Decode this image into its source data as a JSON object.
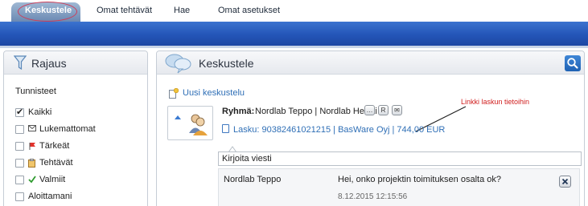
{
  "nav": {
    "tabs": [
      {
        "label": "Keskustele",
        "active": true
      },
      {
        "label": "Omat tehtävät",
        "active": false
      },
      {
        "label": "Hae",
        "active": false
      },
      {
        "label": "Omat asetukset",
        "active": false
      }
    ]
  },
  "filter_panel": {
    "title": "Rajaus",
    "section_label": "Tunnisteet",
    "items": [
      {
        "label": "Kaikki",
        "checked": true,
        "icon": ""
      },
      {
        "label": "Lukemattomat",
        "checked": false,
        "icon": "envelope-icon"
      },
      {
        "label": "Tärkeät",
        "checked": false,
        "icon": "red-flag-icon"
      },
      {
        "label": "Tehtävät",
        "checked": false,
        "icon": "clipboard-icon"
      },
      {
        "label": "Valmiit",
        "checked": false,
        "icon": "green-check-icon"
      },
      {
        "label": "Aloittamani",
        "checked": false,
        "icon": ""
      }
    ]
  },
  "conversation_panel": {
    "title": "Keskustele",
    "new_conversation_label": "Uusi keskustelu",
    "group_label": "Ryhmä:",
    "group_members": "Nordlab Teppo | Nordlab Heikki",
    "invoice_link": "Lasku: 90382461021215 | BasWare Oyj | 744,00 EUR",
    "annotation": "Linkki laskun tietoihin",
    "input_value": "Kirjoita viesti",
    "message": {
      "author": "Nordlab Teppo",
      "text": "Hei, onko projektin toimituksen osalta ok?",
      "timestamp": "8.12.2015 12:15:56"
    }
  },
  "colors": {
    "band_blue": "#2455b8",
    "link_blue": "#2f6fb6",
    "annotation_red": "#d01d1d",
    "oval_red": "#cf3d58"
  }
}
